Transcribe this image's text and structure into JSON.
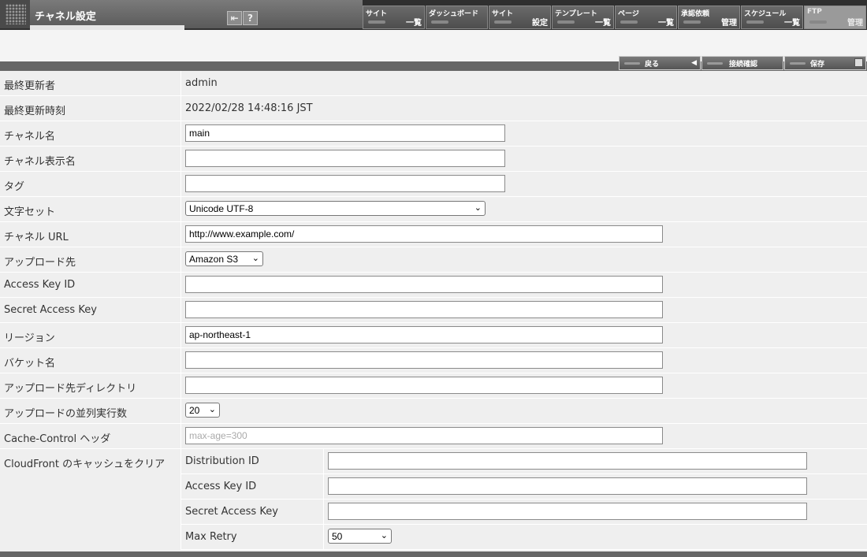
{
  "header": {
    "title": "チャネル設定",
    "nav": [
      {
        "top": "サイト",
        "bottom": "一覧",
        "active": false
      },
      {
        "top": "ダッシュボード",
        "bottom": "",
        "active": false
      },
      {
        "top": "サイト",
        "bottom": "設定",
        "active": false
      },
      {
        "top": "テンプレート",
        "bottom": "一覧",
        "active": false
      },
      {
        "top": "ページ",
        "bottom": "一覧",
        "active": false
      },
      {
        "top": "承認依頼",
        "bottom": "管理",
        "active": false
      },
      {
        "top": "スケジュール",
        "bottom": "一覧",
        "active": false
      },
      {
        "top": "FTP",
        "bottom": "管理",
        "active": true
      }
    ]
  },
  "actions": {
    "back": "戻る",
    "test": "接続確認",
    "save": "保存"
  },
  "form": {
    "last_updater_label": "最終更新者",
    "last_updater": "admin",
    "last_updated_label": "最終更新時刻",
    "last_updated": "2022/02/28 14:48:16 JST",
    "channel_name_label": "チャネル名",
    "channel_name": "main",
    "display_name_label": "チャネル表示名",
    "display_name": "",
    "tag_label": "タグ",
    "tag": "",
    "charset_label": "文字セット",
    "charset": "Unicode UTF-8",
    "url_label": "チャネル URL",
    "url": "http://www.example.com/",
    "upload_to_label": "アップロード先",
    "upload_to": "Amazon S3",
    "access_key_label": "Access Key ID",
    "access_key": "",
    "secret_key_label": "Secret Access Key",
    "secret_key": "",
    "region_label": "リージョン",
    "region": "ap-northeast-1",
    "bucket_label": "バケット名",
    "bucket": "",
    "upload_dir_label": "アップロード先ディレクトリ",
    "upload_dir": "",
    "parallel_label": "アップロードの並列実行数",
    "parallel": "20",
    "cache_control_label": "Cache-Control ヘッダ",
    "cache_control_placeholder": "max-age=300",
    "cloudfront": {
      "label": "CloudFront のキャッシュをクリア",
      "distribution_label": "Distribution ID",
      "distribution": "",
      "access_key_label": "Access Key ID",
      "access_key": "",
      "secret_key_label": "Secret Access Key",
      "secret_key": "",
      "max_retry_label": "Max Retry",
      "max_retry": "50"
    }
  }
}
